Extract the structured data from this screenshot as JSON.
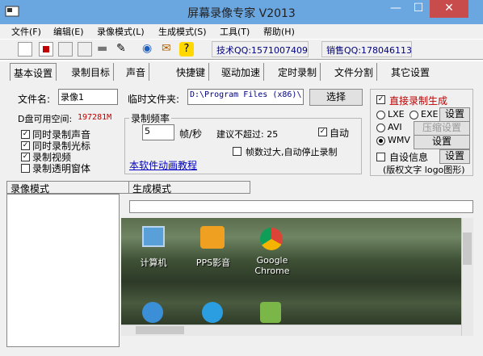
{
  "window": {
    "title": "屏幕录像专家 V2013"
  },
  "menu": [
    "文件(F)",
    "编辑(E)",
    "录像模式(L)",
    "生成模式(S)",
    "工具(T)",
    "帮助(H)"
  ],
  "toolbar": {
    "qq_tech": "技术QQ:1571007409",
    "qq_sales": "销售QQ:178046113"
  },
  "tabs": [
    "基本设置",
    "录制目标",
    "声音",
    "快捷键",
    "驱动加速",
    "定时录制",
    "文件分割",
    "其它设置"
  ],
  "basic": {
    "filename_label": "文件名:",
    "filename_value": "录像1",
    "tempdir_label": "临时文件夹:",
    "tempdir_value": "D:\\Program Files (x86)\\",
    "choose_button": "选择",
    "disk_free_label": "D盘可用空间:",
    "disk_free_value": "197281M",
    "checks": [
      "同时录制声音",
      "同时录制光标",
      "录制视频",
      "录制透明窗体"
    ],
    "checks_state": [
      true,
      true,
      true,
      false
    ],
    "freq_group_title": "录制频率",
    "fps_value": "5",
    "fps_unit": "帧/秒",
    "suggest_label": "建议不超过: 25",
    "auto_label": "自动",
    "auto_stop_label": "帧数过大,自动停止录制",
    "tutorial_link": "本软件动画教程"
  },
  "output": {
    "direct_label": "直接录制生成",
    "formats": [
      "LXE",
      "EXE",
      "AVI",
      "WMV"
    ],
    "selected_format": "WMV",
    "settings_button": "设置",
    "compress_button": "压缩设置",
    "custom_info_label": "自设信息",
    "copyright_label": "(版权文字 logo图形)"
  },
  "lower": {
    "tab_record": "录像模式",
    "tab_generate": "生成模式"
  },
  "desktop": {
    "icons": [
      "计算机",
      "PPS影音",
      "Google Chrome"
    ]
  },
  "colors": {
    "titlebar": "#6aa6e0",
    "red": "#c00000",
    "link": "#0000c0"
  }
}
